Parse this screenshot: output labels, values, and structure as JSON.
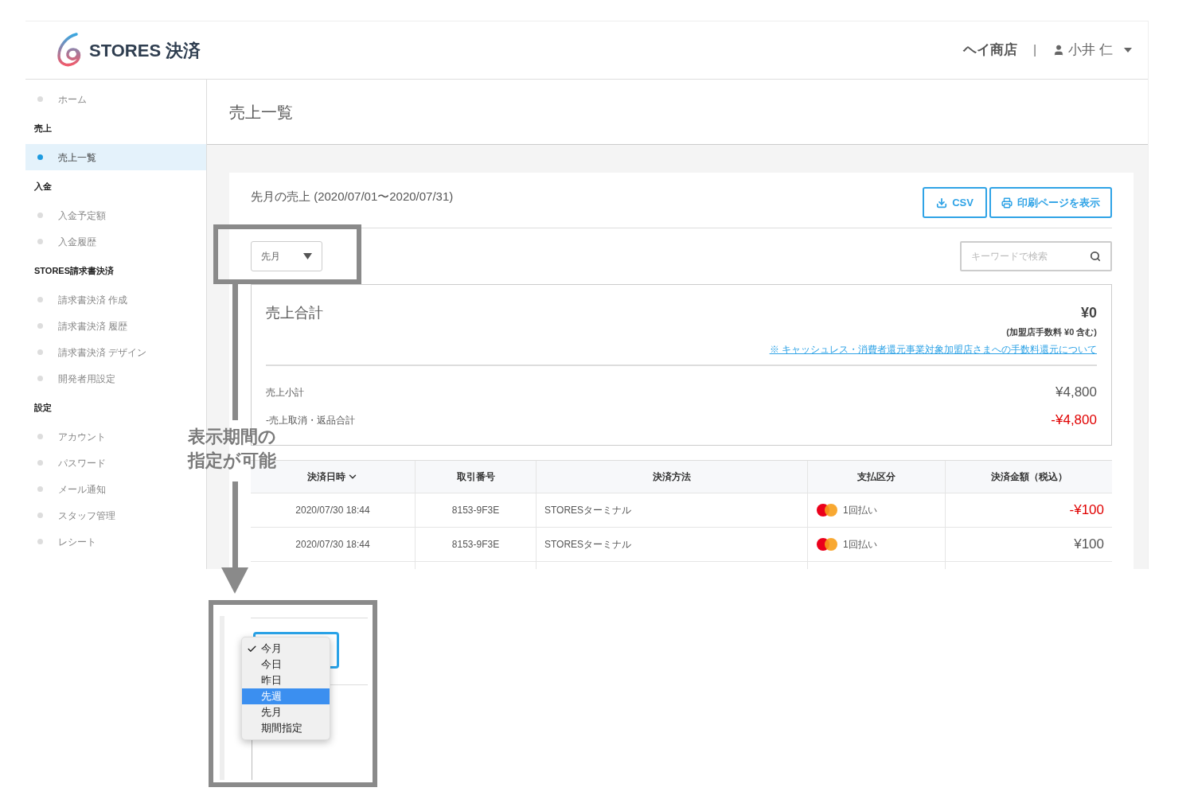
{
  "header": {
    "logo_text": "STORES 決済",
    "shop": "ヘイ商店",
    "separator": "|",
    "user": "小井 仁"
  },
  "sidebar": [
    {
      "kind": "item",
      "label": "ホーム",
      "selected": false
    },
    {
      "kind": "heading",
      "label": "売上"
    },
    {
      "kind": "item",
      "label": "売上一覧",
      "selected": true
    },
    {
      "kind": "heading",
      "label": "入金"
    },
    {
      "kind": "item",
      "label": "入金予定額",
      "selected": false
    },
    {
      "kind": "item",
      "label": "入金履歴",
      "selected": false
    },
    {
      "kind": "heading",
      "label": "STORES請求書決済"
    },
    {
      "kind": "item",
      "label": "請求書決済 作成",
      "selected": false
    },
    {
      "kind": "item",
      "label": "請求書決済 履歴",
      "selected": false
    },
    {
      "kind": "item",
      "label": "請求書決済 デザイン",
      "selected": false
    },
    {
      "kind": "item",
      "label": "開発者用設定",
      "selected": false
    },
    {
      "kind": "heading",
      "label": "設定"
    },
    {
      "kind": "item",
      "label": "アカウント",
      "selected": false
    },
    {
      "kind": "item",
      "label": "パスワード",
      "selected": false
    },
    {
      "kind": "item",
      "label": "メール通知",
      "selected": false
    },
    {
      "kind": "item",
      "label": "スタッフ管理",
      "selected": false
    },
    {
      "kind": "item",
      "label": "レシート",
      "selected": false
    }
  ],
  "page_title": "売上一覧",
  "card": {
    "title": "先月の売上 (2020/07/01〜2020/07/31)",
    "buttons": [
      {
        "kind": "download",
        "label": "CSV"
      },
      {
        "kind": "print",
        "label": "印刷ページを表示"
      }
    ],
    "period_select": {
      "value": "先月"
    },
    "search": {
      "placeholder": "キーワードで検索"
    }
  },
  "summary": {
    "title": "売上合計",
    "total": "¥0",
    "fee_note": "(加盟店手数料 ¥0 含む)",
    "link": "※ キャッシュレス・消費者還元事業対象加盟店さまへの手数料還元について",
    "rows": [
      {
        "label": "売上小計",
        "value": "¥4,800",
        "negative": false
      },
      {
        "label": "-売上取消・返品合計",
        "value": "-¥4,800",
        "negative": true
      }
    ]
  },
  "table": {
    "columns": [
      "決済日時",
      "取引番号",
      "決済方法",
      "支払区分",
      "決済金額（税込）"
    ],
    "rows": [
      {
        "datetime": "2020/07/30 18:44",
        "number": "8153-9F3E",
        "method": "STORESターミナル",
        "payment": "1回払い",
        "amount": "-¥100",
        "negative": true
      },
      {
        "datetime": "2020/07/30 18:44",
        "number": "8153-9F3E",
        "method": "STORESターミナル",
        "payment": "1回払い",
        "amount": "¥100",
        "negative": false
      }
    ]
  },
  "annotation": {
    "callout": [
      "表示期間の",
      "指定が可能"
    ]
  },
  "inset_menu": [
    {
      "label": "今月",
      "checked": true,
      "selected": false
    },
    {
      "label": "今日",
      "checked": false,
      "selected": false
    },
    {
      "label": "昨日",
      "checked": false,
      "selected": false
    },
    {
      "label": "先週",
      "checked": false,
      "selected": true
    },
    {
      "label": "先月",
      "checked": false,
      "selected": false
    },
    {
      "label": "期間指定",
      "checked": false,
      "selected": false
    }
  ]
}
